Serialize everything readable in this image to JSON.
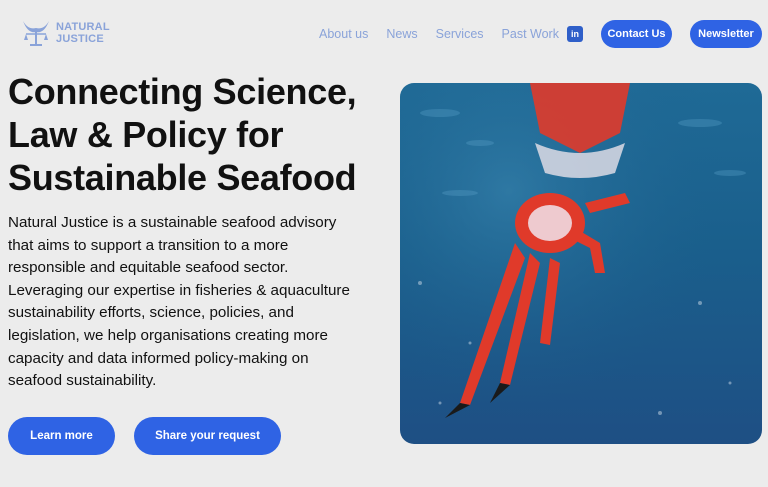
{
  "logo": {
    "line1": "NATURAL",
    "line2": "JUSTICE",
    "icon": "fish-scales-icon"
  },
  "nav": {
    "items": [
      "About us",
      "News",
      "Services",
      "Past Work"
    ],
    "linkedin_icon": "linkedin-icon",
    "contact_label": "Contact Us",
    "newsletter_label": "Newsletter"
  },
  "hero": {
    "headline_lines": [
      "Connecting Science,",
      "Law & Policy for",
      "Sustainable Seafood"
    ],
    "description": "Natural Justice is a sustainable seafood advisory that aims to support a transition to a more responsible and equitable seafood sector. Leveraging our expertise in fisheries & aquaculture sustainability efforts, science, policies, and legislation, we help organisations creating more capacity and data informed policy-making on seafood sustainability.",
    "learn_more_label": "Learn more",
    "share_label": "Share your request",
    "image_alt": "red-crab-underwater-photo"
  },
  "colors": {
    "accent": "#2f63e4",
    "nav_text": "#8aa3d9",
    "background": "#ececec"
  }
}
